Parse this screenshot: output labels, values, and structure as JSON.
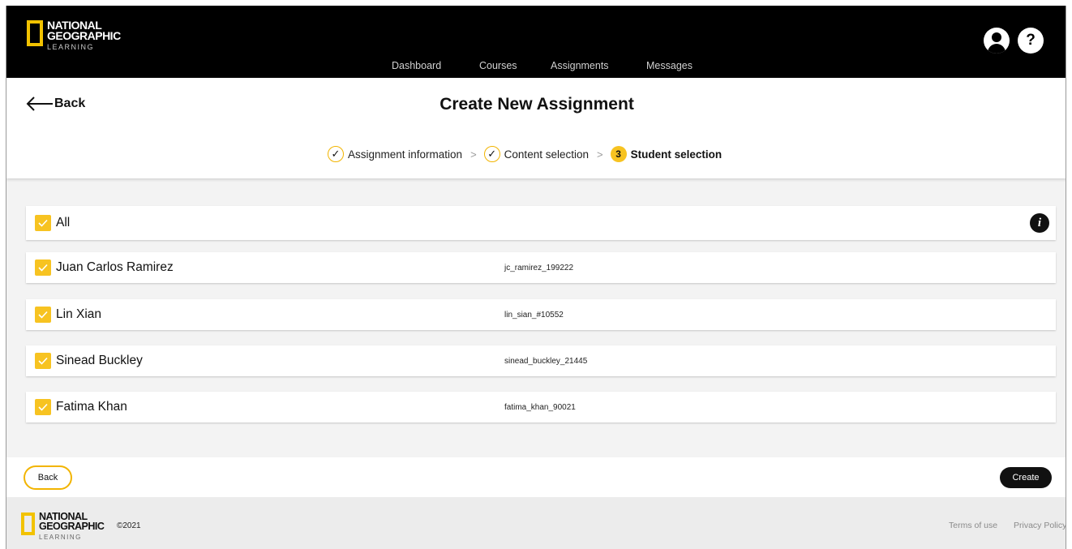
{
  "brand": {
    "line1": "NATIONAL",
    "line2": "GEOGRAPHIC",
    "line3": "LEARNING",
    "accent_color": "#F2C200"
  },
  "nav": {
    "items": [
      {
        "label": "Dashboard"
      },
      {
        "label": "Courses"
      },
      {
        "label": "Assignments"
      },
      {
        "label": "Messages"
      }
    ],
    "right_icons": [
      "user-icon",
      "help-icon"
    ],
    "help_glyph": "?"
  },
  "header": {
    "back_label": "Back",
    "title": "Create New Assignment"
  },
  "stepper": {
    "steps": [
      {
        "label": "Assignment information",
        "status": "completed",
        "glyph": "✓"
      },
      {
        "label": "Content selection",
        "status": "completed",
        "glyph": "✓"
      },
      {
        "label": "Student selection",
        "status": "active",
        "glyph": "3"
      }
    ],
    "separator": ">"
  },
  "students": {
    "all_label": "All",
    "all_checked": true,
    "info_glyph": "i",
    "rows": [
      {
        "name": "Juan Carlos Ramirez",
        "username": "jc_ramirez_199222",
        "checked": true
      },
      {
        "name": "Lin Xian",
        "username": "lin_sian_#10552",
        "checked": true
      },
      {
        "name": "Sinead Buckley",
        "username": "sinead_buckley_21445",
        "checked": true
      },
      {
        "name": "Fatima Khan",
        "username": "fatima_khan_90021",
        "checked": true
      }
    ]
  },
  "actions": {
    "back_label": "Back",
    "create_label": "Create"
  },
  "footer": {
    "copyright": "©2021",
    "terms": "Terms of use",
    "privacy": "Privacy Policy"
  },
  "colors": {
    "topbar": "#000000",
    "checkbox": "#F7C321",
    "primary_button": "#111111"
  }
}
